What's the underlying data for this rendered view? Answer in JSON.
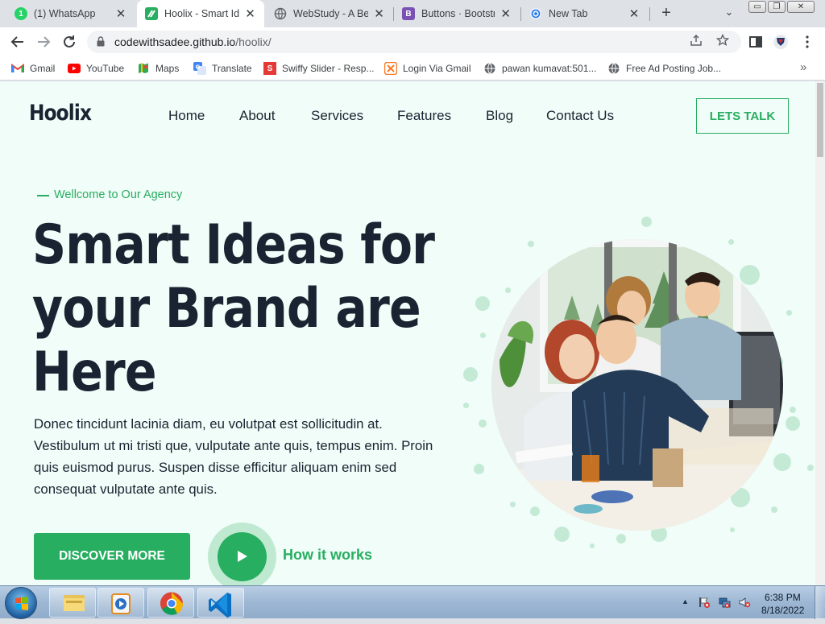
{
  "browser": {
    "tabs": [
      {
        "title": "(1) WhatsApp",
        "icon": "whatsapp-icon",
        "color": "#25d366",
        "active": false
      },
      {
        "title": "Hoolix - Smart Ide",
        "icon": "hoolix-favicon-icon",
        "color": "#27ae60",
        "active": true
      },
      {
        "title": "WebStudy - A Bes",
        "icon": "globe-icon",
        "color": "#5f6368",
        "active": false
      },
      {
        "title": "Buttons · Bootstra",
        "icon": "bootstrap-icon",
        "color": "#7952b3",
        "active": false
      },
      {
        "title": "New Tab",
        "icon": "chrome-newtab-icon",
        "color": "#1a73e8",
        "active": false
      }
    ],
    "close_glyph": "✕",
    "new_tab_glyph": "+",
    "tab_list_glyph": "⌄",
    "window_buttons": [
      "▭",
      "❐",
      "✕"
    ],
    "url_host": "codewithsadee.github.io",
    "url_path": "/hoolix/",
    "bookmarks": [
      {
        "label": "Gmail",
        "icon": "gmail-icon",
        "color": "#ea4335"
      },
      {
        "label": "YouTube",
        "icon": "youtube-icon",
        "color": "#ff0000"
      },
      {
        "label": "Maps",
        "icon": "maps-icon",
        "color": "#34a853"
      },
      {
        "label": "Translate",
        "icon": "translate-icon",
        "color": "#4285f4"
      },
      {
        "label": "Swiffy Slider - Resp...",
        "icon": "swiffy-icon",
        "color": "#e53935"
      },
      {
        "label": "Login Via Gmail",
        "icon": "xampp-icon",
        "color": "#fb7a24"
      },
      {
        "label": "pawan kumavat:501...",
        "icon": "globe-icon",
        "color": "#5f6368"
      },
      {
        "label": "Free Ad Posting Job...",
        "icon": "globe-icon",
        "color": "#5f6368"
      }
    ],
    "bookmarks_more_glyph": "»"
  },
  "site": {
    "logo": "Hoolix",
    "nav": [
      "Home",
      "About",
      "Services",
      "Features",
      "Blog",
      "Contact Us"
    ],
    "cta": "LETS TALK",
    "accent": "#27ae60",
    "dark": "#1a2332",
    "background": "#f0fdf8"
  },
  "hero": {
    "eyebrow": "Wellcome to Our Agency",
    "headline": [
      "Smart Ideas for",
      "your Brand are",
      "Here"
    ],
    "paragraph": "Donec tincidunt lacinia diam, eu volutpat est sollicitudin at. Vestibulum ut mi tristi que, vulputate ante quis, tempus enim. Proin quis euismod purus. Suspen disse efficitur aliquam enim sed consequat vulputate ante quis.",
    "primary_button": "DISCOVER MORE",
    "secondary_link": "How it works"
  },
  "taskbar": {
    "apps": [
      "file-explorer-icon",
      "media-player-icon",
      "chrome-icon",
      "vscode-icon"
    ],
    "time": "6:38 PM",
    "date": "8/18/2022",
    "tray_arrow": "▲"
  }
}
